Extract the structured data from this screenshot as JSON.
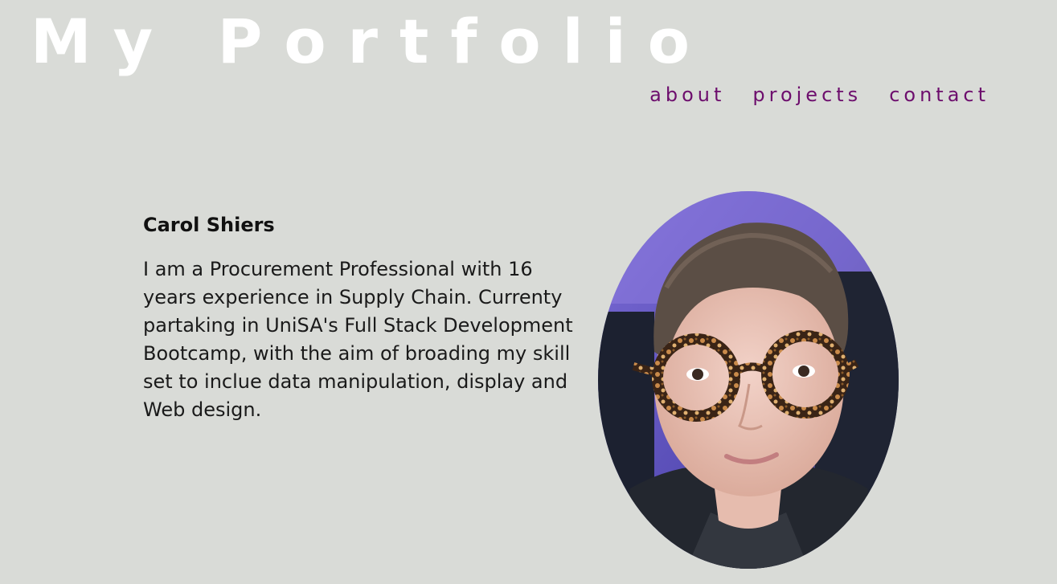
{
  "header": {
    "title": "My Portfolio"
  },
  "nav": {
    "items": [
      {
        "label": "about"
      },
      {
        "label": "projects"
      },
      {
        "label": "contact"
      }
    ]
  },
  "profile": {
    "name": "Carol Shiers",
    "bio": "I am a Procurement Professional with 16 years experience in Supply Chain. Currenty partaking in UniSA's Full Stack Development Bootcamp, with the aim of broading my skill set to inclue data manipulation, display and Web design."
  },
  "colors": {
    "background": "#d9dbd7",
    "title": "#ffffff",
    "nav_link": "#6d0e6d",
    "text": "#1a1a1a"
  }
}
